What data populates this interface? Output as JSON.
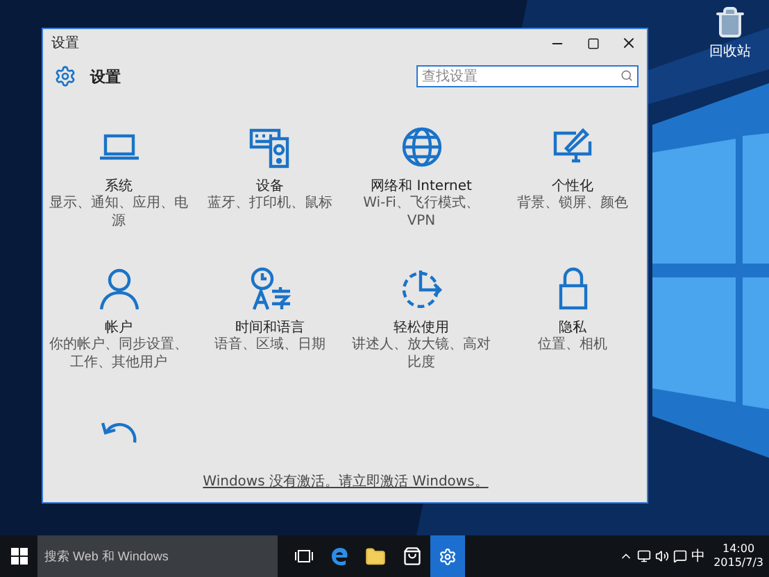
{
  "desktop_icons": [
    {
      "kind": "recycle-bin",
      "label": "回收站"
    }
  ],
  "window": {
    "title": "设置",
    "header": "设置",
    "search": {
      "placeholder": "查找设置"
    },
    "categories": [
      {
        "kind": "laptop",
        "name": "系统",
        "description": "显示、通知、应用、电源"
      },
      {
        "kind": "devices",
        "name": "设备",
        "description": "蓝牙、打印机、鼠标"
      },
      {
        "kind": "globe",
        "name": "网络和 Internet",
        "description": "Wi-Fi、飞行模式、VPN"
      },
      {
        "kind": "personalize",
        "name": "个性化",
        "description": "背景、锁屏、颜色"
      },
      {
        "kind": "person",
        "name": "帐户",
        "description": "你的帐户、同步设置、工作、其他用户"
      },
      {
        "kind": "time",
        "name": "时间和语言",
        "description": "语音、区域、日期"
      },
      {
        "kind": "ease",
        "name": "轻松使用",
        "description": "讲述人、放大镜、高对比度"
      },
      {
        "kind": "lock",
        "name": "隐私",
        "description": "位置、相机"
      },
      {
        "kind": "update"
      }
    ],
    "activation_link": "Windows 没有激活。请立即激活 Windows。"
  },
  "taskbar": {
    "search_placeholder": "搜索 Web 和 Windows",
    "apps": [
      {
        "kind": "task-view",
        "selected": false
      },
      {
        "kind": "edge",
        "selected": false
      },
      {
        "kind": "explorer",
        "selected": false
      },
      {
        "kind": "store",
        "selected": false
      },
      {
        "kind": "settings",
        "selected": true
      }
    ],
    "ime": "中",
    "time": "14:00",
    "date": "2015/7/3"
  }
}
